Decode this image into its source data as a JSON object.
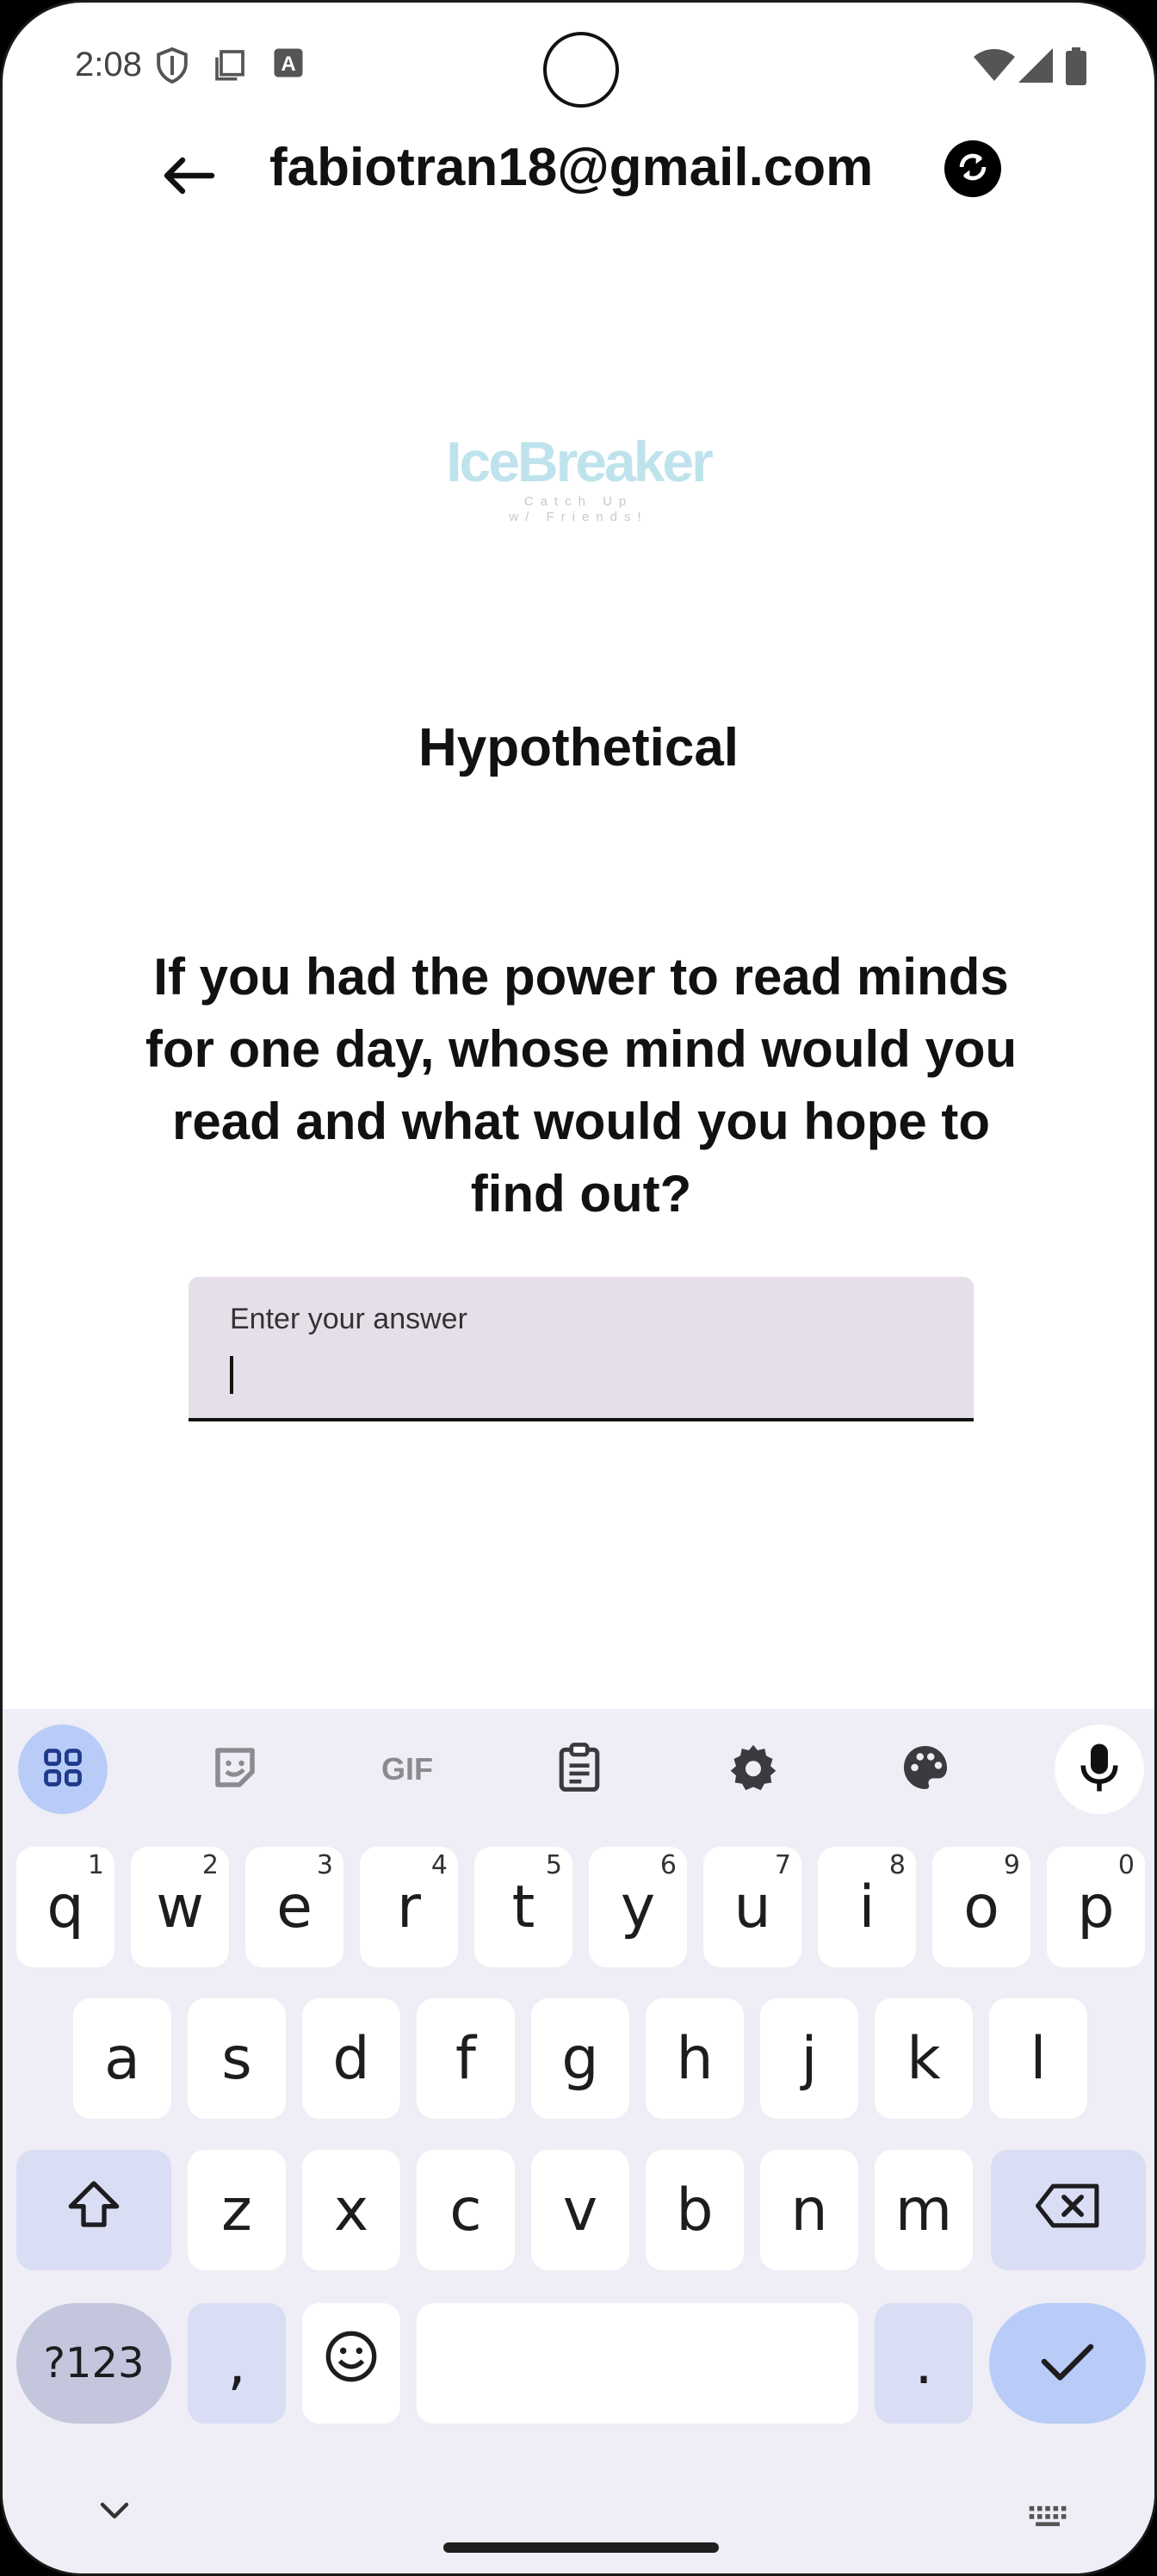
{
  "status_bar": {
    "time": "2:08",
    "icons": [
      "shield-icon",
      "clipboard-icon",
      "font-icon",
      "wifi-icon",
      "signal-icon",
      "battery-icon"
    ]
  },
  "app_bar": {
    "back_icon": "arrow-left-icon",
    "title": "fabiotran18@gmail.com",
    "refresh_icon": "refresh-icon"
  },
  "logo": {
    "name": "IceBreaker",
    "tagline_1": "Catch Up",
    "tagline_2": "w/ Friends!"
  },
  "category": "Hypothetical",
  "question": "If you had the power to read minds for one day, whose mind would you read and what would you hope to find out?",
  "answer_field": {
    "label": "Enter your answer",
    "value": ""
  },
  "keyboard": {
    "toolbar": [
      "apps-icon",
      "sticker-icon",
      "GIF",
      "clipboard-icon",
      "settings-icon",
      "palette-icon",
      "mic-icon"
    ],
    "row1": [
      {
        "k": "q",
        "s": "1"
      },
      {
        "k": "w",
        "s": "2"
      },
      {
        "k": "e",
        "s": "3"
      },
      {
        "k": "r",
        "s": "4"
      },
      {
        "k": "t",
        "s": "5"
      },
      {
        "k": "y",
        "s": "6"
      },
      {
        "k": "u",
        "s": "7"
      },
      {
        "k": "i",
        "s": "8"
      },
      {
        "k": "o",
        "s": "9"
      },
      {
        "k": "p",
        "s": "0"
      }
    ],
    "row2": [
      "a",
      "s",
      "d",
      "f",
      "g",
      "h",
      "j",
      "k",
      "l"
    ],
    "row3": [
      "z",
      "x",
      "c",
      "v",
      "b",
      "n",
      "m"
    ],
    "sym_label": "?123",
    "comma": ",",
    "period": ".",
    "colors": {
      "accent": "#b9ccf8",
      "modifier": "#d9def5",
      "background": "#efedf5"
    }
  }
}
